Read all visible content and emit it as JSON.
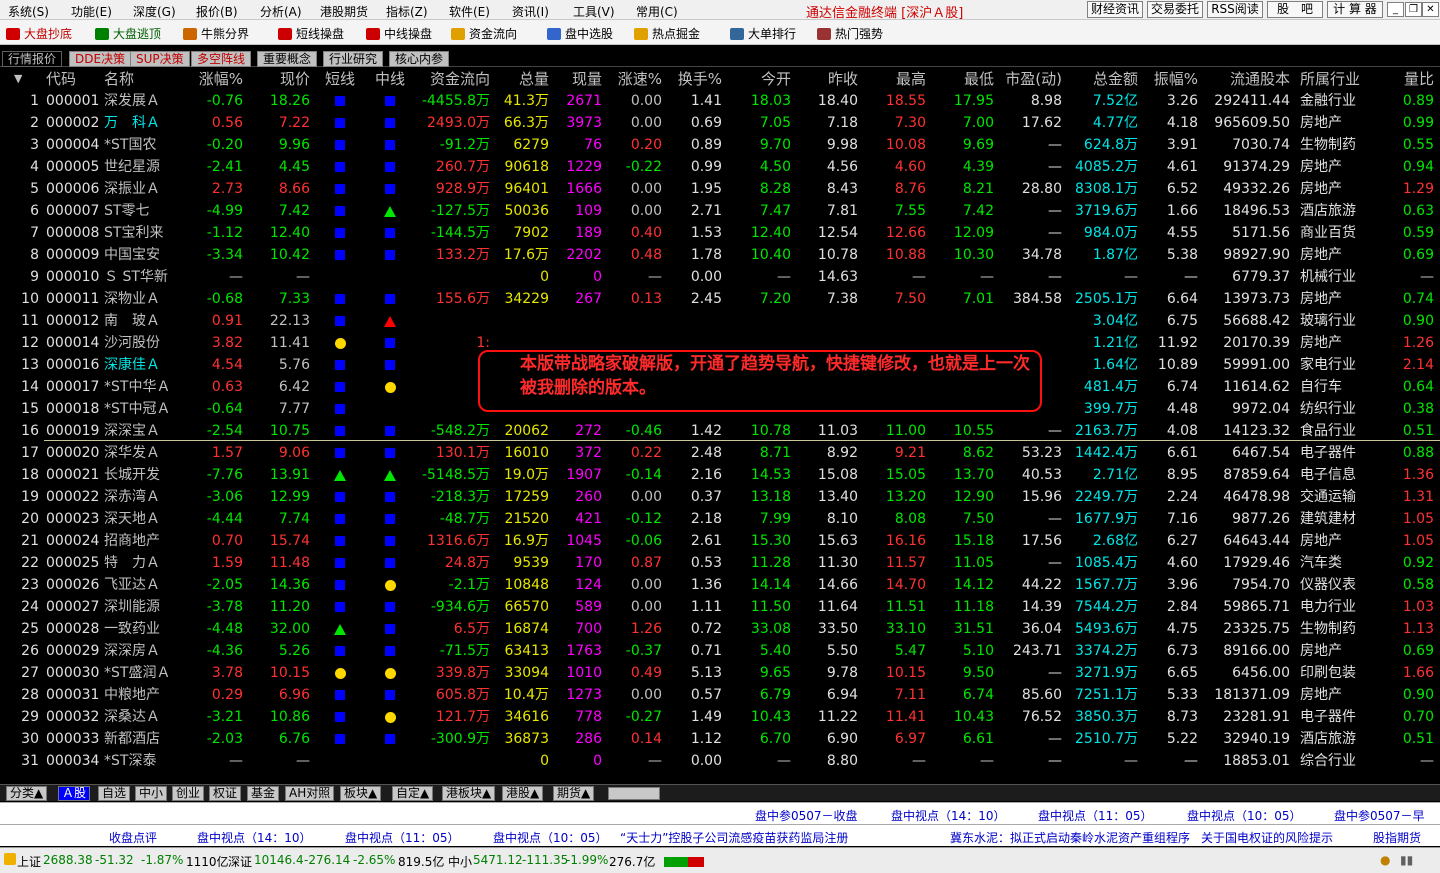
{
  "menu": [
    "系统(S)",
    "功能(E)",
    "深度(G)",
    "报价(B)",
    "分析(A)",
    "港股期货",
    "指标(Z)",
    "软件(E)",
    "资讯(I)",
    "工具(V)",
    "常用(C)"
  ],
  "app_title": "通达信金融终端 [深沪Ａ股]",
  "right_buttons": [
    "财经资讯",
    "交易委托",
    "RSS阅读",
    "股　吧",
    "计 算 器"
  ],
  "toolbar": [
    {
      "label": "大盘抄底",
      "color": "#d00000"
    },
    {
      "label": "大盘逃顶",
      "color": "#008000"
    },
    {
      "label": "牛熊分界",
      "color": "#cc6600"
    },
    {
      "label": "短线操盘",
      "color": "#cc0000"
    },
    {
      "label": "中线操盘",
      "color": "#cc0000"
    },
    {
      "label": "资金流向",
      "color": "#e0a000"
    },
    {
      "label": "盘中选股",
      "color": "#3366cc"
    },
    {
      "label": "热点掘金",
      "color": "#e0a000"
    },
    {
      "label": "大单排行",
      "color": "#336699"
    },
    {
      "label": "热门强势",
      "color": "#993333"
    }
  ],
  "top_tabs": [
    "行情报价",
    "DDE决策",
    "SUP决策",
    "多空阵线",
    "重要概念",
    "行业研究",
    "核心内参"
  ],
  "columns": [
    "代码",
    "名称",
    "涨幅%",
    "现价",
    "短线",
    "中线",
    "资金流向",
    "总量",
    "现量",
    "涨速%",
    "换手%",
    "今开",
    "昨收",
    "最高",
    "最低",
    "市盈(动)",
    "总金额",
    "振幅%",
    "流通股本",
    "所属行业",
    "量比"
  ],
  "rows": [
    [
      "1",
      "000001",
      "深发展Ａ",
      "-0.76",
      "18.26",
      "sq",
      "sq",
      "-4455.8万",
      "41.3万",
      "2671",
      "0.00",
      "1.41",
      "18.03",
      "18.40",
      "18.55",
      "17.95",
      "8.98",
      "7.52亿",
      "3.26",
      "292411.44",
      "金融行业",
      "0.89"
    ],
    [
      "2",
      "000002",
      "万　科Ａ",
      "0.56",
      "7.22",
      "sq",
      "sq",
      "2493.0万",
      "66.3万",
      "3973",
      "0.00",
      "0.69",
      "7.05",
      "7.18",
      "7.30",
      "7.00",
      "17.62",
      "4.77亿",
      "4.18",
      "965609.50",
      "房地产",
      "0.99"
    ],
    [
      "3",
      "000004",
      "*ST国农",
      "-0.20",
      "9.96",
      "sq",
      "sq",
      "-91.2万",
      "6279",
      "76",
      "0.20",
      "0.89",
      "9.70",
      "9.98",
      "10.08",
      "9.69",
      "—",
      "624.8万",
      "3.91",
      "7030.74",
      "生物制药",
      "0.55"
    ],
    [
      "4",
      "000005",
      "世纪星源",
      "-2.41",
      "4.45",
      "sq",
      "sq",
      "260.7万",
      "90618",
      "1229",
      "-0.22",
      "0.99",
      "4.50",
      "4.56",
      "4.60",
      "4.39",
      "—",
      "4085.2万",
      "4.61",
      "91374.29",
      "房地产",
      "0.94"
    ],
    [
      "5",
      "000006",
      "深振业Ａ",
      "2.73",
      "8.66",
      "sq",
      "sq",
      "928.9万",
      "96401",
      "1666",
      "0.00",
      "1.95",
      "8.28",
      "8.43",
      "8.76",
      "8.21",
      "28.80",
      "8308.1万",
      "6.52",
      "49332.26",
      "房地产",
      "1.29"
    ],
    [
      "6",
      "000007",
      "ST零七",
      "-4.99",
      "7.42",
      "sq",
      "tg",
      "-127.5万",
      "50036",
      "109",
      "0.00",
      "2.71",
      "7.47",
      "7.81",
      "7.55",
      "7.42",
      "—",
      "3719.6万",
      "1.66",
      "18496.53",
      "酒店旅游",
      "0.63"
    ],
    [
      "7",
      "000008",
      "ST宝利来",
      "-1.12",
      "12.40",
      "sq",
      "sq",
      "-144.5万",
      "7902",
      "189",
      "0.40",
      "1.53",
      "12.40",
      "12.54",
      "12.66",
      "12.09",
      "—",
      "984.0万",
      "4.55",
      "5171.56",
      "商业百货",
      "0.59"
    ],
    [
      "8",
      "000009",
      "中国宝安",
      "-3.34",
      "10.42",
      "sq",
      "sq",
      "133.2万",
      "17.6万",
      "2202",
      "0.48",
      "1.78",
      "10.40",
      "10.78",
      "10.88",
      "10.30",
      "34.78",
      "1.87亿",
      "5.38",
      "98927.90",
      "房地产",
      "0.69"
    ],
    [
      "9",
      "000010",
      "Ｓ ST华新",
      "—",
      "—",
      "",
      "",
      "",
      "0",
      "0",
      "—",
      "0.00",
      "—",
      "14.63",
      "—",
      "—",
      "—",
      "—",
      "—",
      "6779.37",
      "机械行业",
      "—"
    ],
    [
      "10",
      "000011",
      "深物业Ａ",
      "-0.68",
      "7.33",
      "sq",
      "sq",
      "155.6万",
      "34229",
      "267",
      "0.13",
      "2.45",
      "7.20",
      "7.38",
      "7.50",
      "7.01",
      "384.58",
      "2505.1万",
      "6.64",
      "13973.73",
      "房地产",
      "0.74"
    ],
    [
      "11",
      "000012",
      "南　玻Ａ",
      "0.91",
      "22.13",
      "sq",
      "tr",
      "",
      "",
      "",
      "",
      "",
      "",
      "",
      "",
      "",
      "",
      "3.04亿",
      "6.75",
      "56688.42",
      "玻璃行业",
      "0.90"
    ],
    [
      "12",
      "000014",
      "沙河股份",
      "3.82",
      "11.41",
      "ci",
      "sq",
      "1:",
      "",
      "",
      "",
      "",
      "",
      "",
      "",
      "",
      "",
      "1.21亿",
      "11.92",
      "20170.39",
      "房地产",
      "1.26"
    ],
    [
      "13",
      "000016",
      "深康佳Ａ",
      "4.54",
      "5.76",
      "sq",
      "sq",
      "-",
      "",
      "",
      "",
      "",
      "",
      "",
      "",
      "",
      "",
      "1.64亿",
      "10.89",
      "59991.00",
      "家电行业",
      "2.14"
    ],
    [
      "14",
      "000017",
      "*ST中华Ａ",
      "0.63",
      "6.42",
      "sq",
      "ci",
      "",
      "",
      "",
      "",
      "",
      "",
      "",
      "",
      "",
      "",
      "481.4万",
      "6.74",
      "11614.62",
      "自行车",
      "0.64"
    ],
    [
      "15",
      "000018",
      "*ST中冠Ａ",
      "-0.64",
      "7.77",
      "sq",
      "",
      "",
      "",
      "",
      "",
      "",
      "",
      "",
      "",
      "",
      "",
      "399.7万",
      "4.48",
      "9972.04",
      "纺织行业",
      "0.38"
    ],
    [
      "16",
      "000019",
      "深深宝Ａ",
      "-2.54",
      "10.75",
      "sq",
      "sq",
      "-548.2万",
      "20062",
      "272",
      "-0.46",
      "1.42",
      "10.78",
      "11.03",
      "11.00",
      "10.55",
      "—",
      "2163.7万",
      "4.08",
      "14123.32",
      "食品行业",
      "0.51"
    ],
    [
      "17",
      "000020",
      "深华发Ａ",
      "1.57",
      "9.06",
      "sq",
      "sq",
      "130.1万",
      "16010",
      "372",
      "0.22",
      "2.48",
      "8.71",
      "8.92",
      "9.21",
      "8.62",
      "53.23",
      "1442.4万",
      "6.61",
      "6467.54",
      "电子器件",
      "0.88"
    ],
    [
      "18",
      "000021",
      "长城开发",
      "-7.76",
      "13.91",
      "tg",
      "tg",
      "-5148.5万",
      "19.0万",
      "1907",
      "-0.14",
      "2.16",
      "14.53",
      "15.08",
      "15.05",
      "13.70",
      "40.53",
      "2.71亿",
      "8.95",
      "87859.64",
      "电子信息",
      "1.36"
    ],
    [
      "19",
      "000022",
      "深赤湾Ａ",
      "-3.06",
      "12.99",
      "sq",
      "sq",
      "-218.3万",
      "17259",
      "260",
      "0.00",
      "0.37",
      "13.18",
      "13.40",
      "13.20",
      "12.90",
      "15.96",
      "2249.7万",
      "2.24",
      "46478.98",
      "交通运输",
      "1.31"
    ],
    [
      "20",
      "000023",
      "深天地Ａ",
      "-4.44",
      "7.74",
      "sq",
      "sq",
      "-48.7万",
      "21520",
      "421",
      "-0.12",
      "2.18",
      "7.99",
      "8.10",
      "8.08",
      "7.50",
      "—",
      "1677.9万",
      "7.16",
      "9877.26",
      "建筑建材",
      "1.05"
    ],
    [
      "21",
      "000024",
      "招商地产",
      "0.70",
      "15.74",
      "sq",
      "sq",
      "1316.6万",
      "16.9万",
      "1045",
      "-0.06",
      "2.61",
      "15.30",
      "15.63",
      "16.16",
      "15.18",
      "17.56",
      "2.68亿",
      "6.27",
      "64643.44",
      "房地产",
      "1.05"
    ],
    [
      "22",
      "000025",
      "特　力Ａ",
      "1.59",
      "11.48",
      "sq",
      "sq",
      "24.8万",
      "9539",
      "170",
      "0.87",
      "0.53",
      "11.28",
      "11.30",
      "11.57",
      "11.05",
      "—",
      "1085.4万",
      "4.60",
      "17929.46",
      "汽车类",
      "0.92"
    ],
    [
      "23",
      "000026",
      "飞亚达Ａ",
      "-2.05",
      "14.36",
      "sq",
      "ci",
      "-2.1万",
      "10848",
      "124",
      "0.00",
      "1.36",
      "14.14",
      "14.66",
      "14.70",
      "14.12",
      "44.22",
      "1567.7万",
      "3.96",
      "7954.70",
      "仪器仪表",
      "0.58"
    ],
    [
      "24",
      "000027",
      "深圳能源",
      "-3.78",
      "11.20",
      "sq",
      "sq",
      "-934.6万",
      "66570",
      "589",
      "0.00",
      "1.11",
      "11.50",
      "11.64",
      "11.51",
      "11.18",
      "14.39",
      "7544.2万",
      "2.84",
      "59865.71",
      "电力行业",
      "1.03"
    ],
    [
      "25",
      "000028",
      "一致药业",
      "-4.48",
      "32.00",
      "tg",
      "sq",
      "6.5万",
      "16874",
      "700",
      "1.26",
      "0.72",
      "33.08",
      "33.50",
      "33.10",
      "31.51",
      "36.04",
      "5493.6万",
      "4.75",
      "23325.75",
      "生物制药",
      "1.13"
    ],
    [
      "26",
      "000029",
      "深深房Ａ",
      "-4.36",
      "5.26",
      "sq",
      "sq",
      "-71.5万",
      "63413",
      "1763",
      "-0.37",
      "0.71",
      "5.40",
      "5.50",
      "5.47",
      "5.10",
      "243.71",
      "3374.2万",
      "6.73",
      "89166.00",
      "房地产",
      "0.69"
    ],
    [
      "27",
      "000030",
      "*ST盛润Ａ",
      "3.78",
      "10.15",
      "ci",
      "ci",
      "339.8万",
      "33094",
      "1010",
      "0.49",
      "5.13",
      "9.65",
      "9.78",
      "10.15",
      "9.50",
      "—",
      "3271.9万",
      "6.65",
      "6456.00",
      "印刷包装",
      "1.66"
    ],
    [
      "28",
      "000031",
      "中粮地产",
      "0.29",
      "6.96",
      "sq",
      "sq",
      "605.8万",
      "10.4万",
      "1273",
      "0.00",
      "0.57",
      "6.79",
      "6.94",
      "7.11",
      "6.74",
      "85.60",
      "7251.1万",
      "5.33",
      "181371.09",
      "房地产",
      "0.90"
    ],
    [
      "29",
      "000032",
      "深桑达Ａ",
      "-3.21",
      "10.86",
      "sq",
      "ci",
      "121.7万",
      "34616",
      "778",
      "-0.27",
      "1.49",
      "10.43",
      "11.22",
      "11.41",
      "10.43",
      "76.52",
      "3850.3万",
      "8.73",
      "23281.91",
      "电子器件",
      "0.70"
    ],
    [
      "30",
      "000033",
      "新都酒店",
      "-2.03",
      "6.76",
      "sq",
      "sq",
      "-300.9万",
      "36873",
      "286",
      "0.14",
      "1.12",
      "6.70",
      "6.90",
      "6.97",
      "6.61",
      "—",
      "2510.7万",
      "5.22",
      "32940.19",
      "酒店旅游",
      "0.51"
    ],
    [
      "31",
      "000034",
      "*ST深泰",
      "—",
      "—",
      "",
      "",
      "",
      "0",
      "0",
      "—",
      "0.00",
      "—",
      "8.80",
      "—",
      "—",
      "—",
      "—",
      "—",
      "18853.01",
      "综合行业",
      "—"
    ]
  ],
  "overlay_text": "本版带战略家破解版，开通了趋势导航，快捷键修改，也就是上一次被我删除的版本。",
  "bottom_tabs": [
    "分类▲",
    "Ａ股",
    "自选",
    "中小",
    "创业",
    "权证",
    "基金",
    "AH对照",
    "板块▲",
    "自定▲",
    "港板块▲",
    "港股▲",
    "期货▲"
  ],
  "ticker1": [
    "盘中参0507－收盘",
    "盘中视点（14：10）",
    "盘中视点（11：05）",
    "盘中视点（10：05）",
    "盘中参0507－早"
  ],
  "ticker2": [
    "收盘点评",
    "盘中视点（14：10）",
    "盘中视点（11：05）",
    "盘中视点（10：05）",
    "“天士力”控股子公司流感疫苗获药监局注册",
    "冀东水泥：拟正式启动秦岭水泥资产重组程序",
    "关于国电权证的风险提示",
    "股指期货"
  ],
  "status": {
    "sh_label": "上证",
    "sh_val": "2688.38",
    "sh_chg": "-51.32",
    "sh_pct": "-1.87%",
    "sh_amt": "1110亿",
    "sz_label": "深证",
    "sz_val": "10146.4",
    "sz_chg": "-276.14",
    "sz_pct": "-2.65%",
    "sz_amt": "819.5亿",
    "zx_label": "中小",
    "zx_val": "5471.12",
    "zx_chg": "-111.35",
    "zx_pct": "-1.99%",
    "zx_amt": "276.7亿"
  }
}
